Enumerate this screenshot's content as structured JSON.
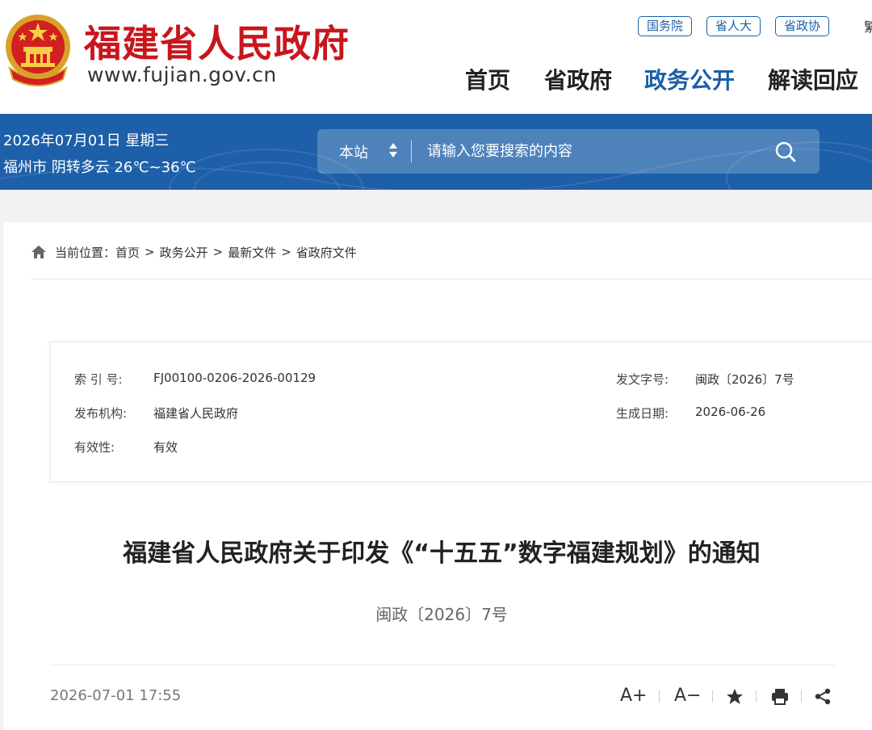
{
  "header": {
    "site_name": "福建省人民政府",
    "site_url": "www.fujian.gov.cn",
    "quick_links": [
      "国务院",
      "省人大",
      "省政协"
    ],
    "cut_char": "繁",
    "nav": [
      {
        "label": "首页",
        "active": false
      },
      {
        "label": "省政府",
        "active": false
      },
      {
        "label": "政务公开",
        "active": true
      },
      {
        "label": "解读回应",
        "active": false
      }
    ]
  },
  "band": {
    "date": "2026年07月01日 星期三",
    "weather": "福州市 阴转多云 26℃~36℃",
    "search_scope": "本站",
    "search_placeholder": "请输入您要搜索的内容"
  },
  "breadcrumb": {
    "prefix": "当前位置：",
    "items": [
      "首页",
      "政务公开",
      "最新文件",
      "省政府文件"
    ],
    "separator": ">"
  },
  "meta": {
    "index_label": "索 引 号:",
    "index_value": "FJ00100-0206-2026-00129",
    "issuer_label": "发布机构:",
    "issuer_value": "福建省人民政府",
    "validity_label": "有效性:",
    "validity_value": "有效",
    "docno_label": "发文字号:",
    "docno_value": "闽政〔2026〕7号",
    "date_label": "生成日期:",
    "date_value": "2026-06-26"
  },
  "article": {
    "title": "福建省人民政府关于印发《“十五五”数字福建规划》的通知",
    "doc_number": "闽政〔2026〕7号",
    "publish_time": "2026-07-01 17:55"
  },
  "tools": {
    "font_larger": "A+",
    "font_smaller": "A−"
  },
  "colors": {
    "brand_red": "#c8161d",
    "brand_blue": "#1d5fa8"
  }
}
